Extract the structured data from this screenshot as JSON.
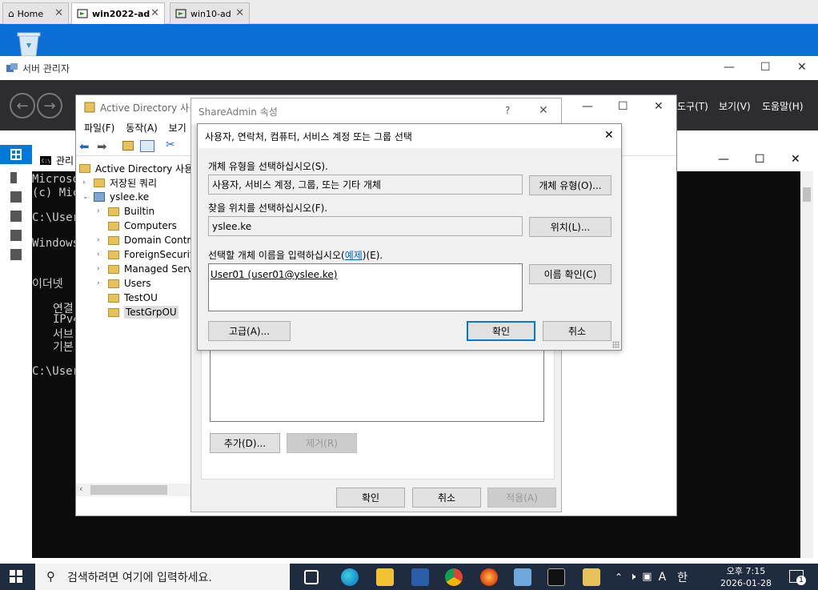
{
  "host_tabs": [
    {
      "label": "Home"
    },
    {
      "label": "win2022-ad"
    },
    {
      "label": "win10-ad"
    }
  ],
  "server_manager": {
    "title": "서버 관리자",
    "menu": [
      "도구(T)",
      "보기(V)",
      "도움말(H)"
    ]
  },
  "console": {
    "title": "관리",
    "lines": [
      "Microso",
      "(c) Mic",
      "C:\\User",
      "Windows",
      "이더넷",
      "연결",
      "IPv4",
      "서브",
      "기본",
      "C:\\User"
    ]
  },
  "aduc": {
    "title": "Active Directory 사용",
    "menu": [
      "파일(F)",
      "동작(A)",
      "보기"
    ],
    "tree": [
      {
        "label": "Active Directory 사용자",
        "arrow": ""
      },
      {
        "label": "저장된 쿼리",
        "arrow": "›"
      },
      {
        "label": "yslee.ke",
        "arrow": "⌄"
      },
      {
        "label": "Builtin",
        "arrow": "›"
      },
      {
        "label": "Computers",
        "arrow": ""
      },
      {
        "label": "Domain Contro",
        "arrow": "›"
      },
      {
        "label": "ForeignSecurity",
        "arrow": "›"
      },
      {
        "label": "Managed Servi",
        "arrow": "›"
      },
      {
        "label": "Users",
        "arrow": "›"
      },
      {
        "label": "TestOU",
        "arrow": ""
      },
      {
        "label": "TestGrpOU",
        "arrow": ""
      }
    ]
  },
  "properties": {
    "title": "ShareAdmin 속성",
    "help": "?",
    "add_label": "추가(D)...",
    "remove_label": "제거(R)",
    "ok_label": "확인",
    "cancel_label": "취소",
    "apply_label": "적용(A)"
  },
  "select_dialog": {
    "title": "사용자, 연락처, 컴퓨터, 서비스 계정 또는 그룹 선택",
    "object_type_label": "개체 유형을 선택하십시오(S).",
    "object_type_value": "사용자, 서비스 계정, 그룹, 또는 기타 개체",
    "object_type_button": "개체 유형(O)...",
    "location_label": "찾을 위치를 선택하십시오(F).",
    "location_value": "yslee.ke",
    "location_button": "위치(L)...",
    "name_label_prefix": "선택할 개체 이름을 입력하십시오(",
    "name_label_link": "예제",
    "name_label_suffix": ")(E).",
    "name_value": "User01 (user01@yslee.ke)",
    "check_names_button": "이름 확인(C)",
    "advanced_button": "고급(A)...",
    "ok_label": "확인",
    "cancel_label": "취소"
  },
  "taskbar": {
    "search_placeholder": "검색하려면 여기에 입력하세요.",
    "ime_letter": "A",
    "ime_lang": "한",
    "time": "오후 7:15",
    "date": "2026-01-28",
    "notification_count": "1"
  },
  "colors": {
    "accent": "#0078d7",
    "taskbar": "#1f2b3e",
    "sm_bar": "#2d2d30"
  }
}
